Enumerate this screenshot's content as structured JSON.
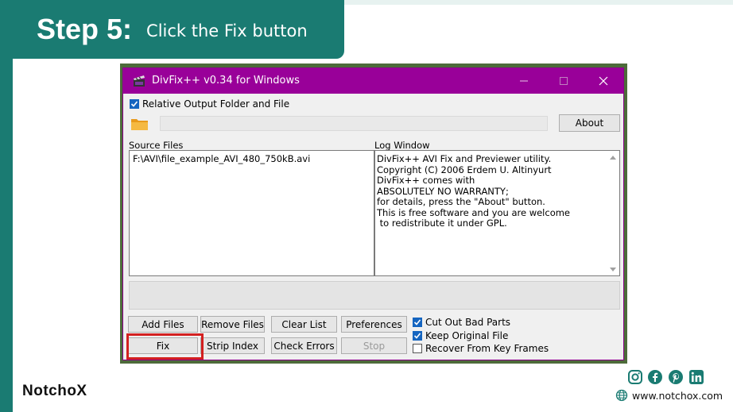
{
  "banner": {
    "step": "Step 5:",
    "instruction": "Click the Fix button"
  },
  "window": {
    "title": "DivFix++ v0.34  for Windows",
    "relative_output_label": "Relative Output Folder and File",
    "relative_output_checked": true,
    "path_value": "",
    "about_label": "About",
    "source_files_label": "Source Files",
    "source_files": [
      "F:\\AVI\\file_example_AVI_480_750kB.avi"
    ],
    "log_label": "Log Window",
    "log_lines": [
      "DivFix++ AVI Fix and Previewer utility.",
      "Copyright (C) 2006 Erdem U. Altinyurt",
      "",
      "DivFix++ comes with",
      "ABSOLUTELY NO WARRANTY;",
      "for details, press the \"About\" button.",
      "",
      "This is free software and you are welcome",
      " to redistribute it under GPL."
    ],
    "buttons": {
      "add_files": "Add Files",
      "remove_files": "Remove Files",
      "clear_list": "Clear List",
      "preferences": "Preferences",
      "fix": "Fix",
      "strip_index": "Strip Index",
      "check_errors": "Check Errors",
      "stop": "Stop"
    },
    "options": {
      "cut_out_bad_parts": "Cut Out Bad Parts",
      "keep_original_file": "Keep Original File",
      "recover_from_key_frames": "Recover From Key Frames"
    }
  },
  "footer": {
    "brand": "NotchoX",
    "website": "www.notchox.com"
  },
  "colors": {
    "teal": "#1a7b72",
    "titlebar": "#990099",
    "highlight": "#d32020"
  }
}
